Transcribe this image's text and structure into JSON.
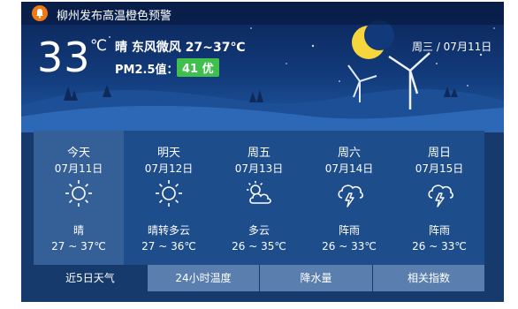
{
  "alert": {
    "text": "柳州发布高温橙色预警"
  },
  "current": {
    "temp": "33",
    "unit": "℃",
    "description": "晴  东风微风  27~37℃",
    "pm_label": "PM2.5值：",
    "aqi": "41 优",
    "date": "周三 / 07月11日"
  },
  "forecast": [
    {
      "name": "今天",
      "date": "07月11日",
      "icon": "sun-icon",
      "condition": "晴",
      "range": "27 ~ 37℃"
    },
    {
      "name": "明天",
      "date": "07月12日",
      "icon": "sun-icon",
      "condition": "晴转多云",
      "range": "27 ~ 36℃"
    },
    {
      "name": "周五",
      "date": "07月13日",
      "icon": "partly-cloudy-icon",
      "condition": "多云",
      "range": "26 ~ 35℃"
    },
    {
      "name": "周六",
      "date": "07月14日",
      "icon": "thunder-rain-icon",
      "condition": "阵雨",
      "range": "26 ~ 33℃"
    },
    {
      "name": "周日",
      "date": "07月15日",
      "icon": "thunder-rain-icon",
      "condition": "阵雨",
      "range": "26 ~ 33℃"
    }
  ],
  "tabs": [
    "近5日天气",
    "24小时温度",
    "降水量",
    "相关指数"
  ],
  "colors": {
    "aqi_good": "#3fbf4b",
    "alert": "#f07a12",
    "panel": "#1e4d8c"
  }
}
